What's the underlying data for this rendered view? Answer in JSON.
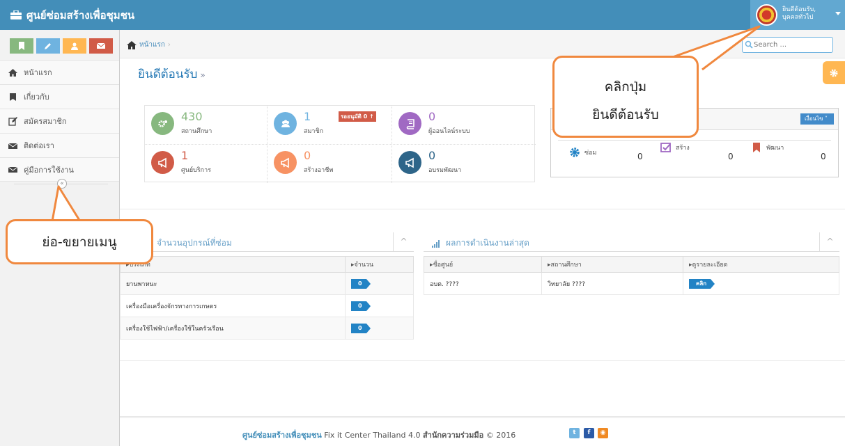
{
  "navbar": {
    "brand": "ศูนย์ซ่อมสร้างเพื่อชุมชน",
    "user_greeting": "ยินดีต้อนรับ,",
    "user_name": "บุคคลทั่วไป"
  },
  "colors": {
    "navbar": "#438eb9",
    "accent": "#f0883e",
    "success": "#87b87f",
    "info": "#6fb3e0",
    "warning": "#ffb752",
    "danger": "#d15b47"
  },
  "sidebar": {
    "shortcuts": [
      {
        "icon": "bookmark-icon",
        "color": "#87b87f"
      },
      {
        "icon": "pencil-icon",
        "color": "#6fb3e0"
      },
      {
        "icon": "users-icon",
        "color": "#ffb752"
      },
      {
        "icon": "envelope-icon",
        "color": "#d15b47"
      }
    ],
    "items": [
      {
        "label": "หน้าแรก",
        "icon": "home-icon"
      },
      {
        "label": "เกี่ยวกับ",
        "icon": "bookmark-icon"
      },
      {
        "label": "สมัครสมาชิก",
        "icon": "edit-icon"
      },
      {
        "label": "ติดต่อเรา",
        "icon": "envelope-icon"
      },
      {
        "label": "คู่มือการใช้งาน",
        "icon": "envelope-icon"
      }
    ],
    "collapse_symbol": "«"
  },
  "breadcrumb": {
    "home": "หน้าแรก",
    "separator": "›"
  },
  "search": {
    "placeholder": "Search ..."
  },
  "page": {
    "title": "ยินดีต้อนรับ",
    "title_suffix": "»"
  },
  "stats": [
    {
      "value": "430",
      "label": "สถานศึกษา",
      "color": "#87b87f",
      "icon": "cogs-icon"
    },
    {
      "value": "1",
      "label": "สมาชิก",
      "color": "#6fb3e0",
      "icon": "users-icon",
      "badge": "รออนุมัติ 0 ↑"
    },
    {
      "value": "0",
      "label": "ผู้ออนไลน์ระบบ",
      "color": "#a069c3",
      "icon": "book-icon"
    },
    {
      "value": "1",
      "label": "ศูนย์บริการ",
      "color": "#d15b47",
      "icon": "bullhorn-icon"
    },
    {
      "value": "0",
      "label": "สร้างอาชีพ",
      "color": "#f79263",
      "icon": "bullhorn-icon"
    },
    {
      "value": "0",
      "label": "อบรมพัฒนา",
      "color": "#2e6589",
      "icon": "bullhorn-icon"
    }
  ],
  "widget_right": {
    "dropdown_label": "เงื่อนไข ˅",
    "items": [
      {
        "label": "ซ่อม",
        "value": "0",
        "icon": "cog-icon"
      },
      {
        "label": "สร้าง",
        "value": "0",
        "icon": "check-square-icon"
      },
      {
        "label": "พัฒนา",
        "value": "0",
        "icon": "bookmark-icon"
      }
    ]
  },
  "equipment_widget": {
    "title": "จำนวนอุปกรณ์ที่ซ่อม",
    "toggle": "^",
    "headers": [
      "▸ประเภท",
      "▸จำนวน"
    ],
    "rows": [
      {
        "type": "ยานพาหนะ",
        "count": "0"
      },
      {
        "type": "เครื่องมือเครื่องจักรทางการเกษตร",
        "count": "0"
      },
      {
        "type": "เครื่องใช้ไฟฟ้า/เครื่องใช้ในครัวเรือน",
        "count": "0"
      }
    ]
  },
  "results_widget": {
    "title": "ผลการดำเนินงานล่าสุด",
    "toggle": "^",
    "headers": [
      "▸ชื่อศูนย์",
      "▸สถานศึกษา",
      "▸ดูรายละเอียด"
    ],
    "rows": [
      {
        "center": "อบต. ????",
        "school": "วิทยาลัย ????",
        "action": "คลิก"
      }
    ]
  },
  "footer": {
    "brand": "ศูนย์ซ่อมสร้างเพื่อชุมชน",
    "text": " Fix it Center Thailand 4.0 ",
    "org": "สำนักความร่วมมือ",
    "copyright": " © 2016",
    "social": [
      "twitter-icon",
      "facebook-icon",
      "rss-icon"
    ]
  },
  "annotations": {
    "left": "ย่อ-ขยายเมนู",
    "right_line1": "คลิกปุ่ม",
    "right_line2": "ยินดีต้อนรับ"
  }
}
